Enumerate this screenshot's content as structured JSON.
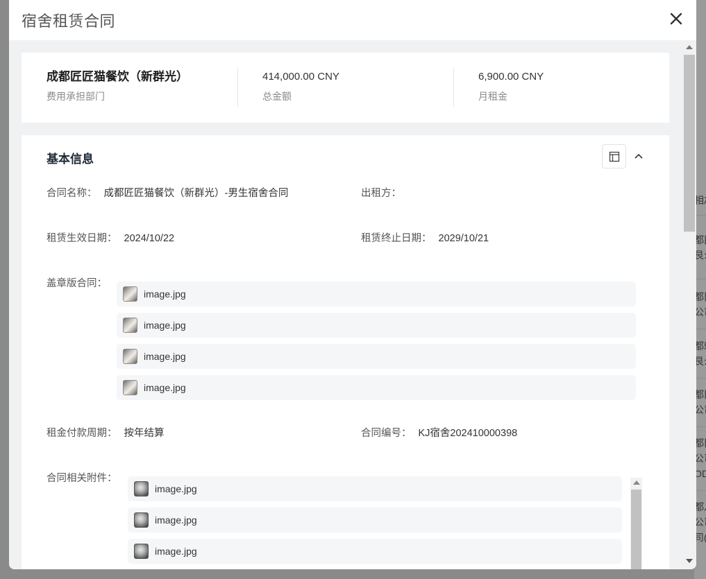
{
  "modal": {
    "title": "宿舍租赁合同"
  },
  "summary": [
    {
      "value": "成都匠匠猫餐饮（新群光）",
      "label": "费用承担部门"
    },
    {
      "value": "414,000.00 CNY",
      "label": "总金额"
    },
    {
      "value": "6,900.00 CNY",
      "label": "月租金"
    }
  ],
  "section": {
    "title": "基本信息"
  },
  "fields": {
    "contract_name": {
      "label": "合同名称：",
      "value": "成都匠匠猫餐饮（新群光）-男生宿舍合同"
    },
    "lessor": {
      "label": "出租方：",
      "value": ""
    },
    "start_date": {
      "label": "租赁生效日期：",
      "value": "2024/10/22"
    },
    "end_date": {
      "label": "租赁终止日期：",
      "value": "2029/10/21"
    },
    "stamped_contract": {
      "label": "盖章版合同："
    },
    "payment_cycle": {
      "label": "租金付款周期：",
      "value": "按年结算"
    },
    "contract_no": {
      "label": "合同编号：",
      "value": "KJ宿舍202410000398"
    },
    "attachments": {
      "label": "合同相关附件："
    }
  },
  "stamped_files": [
    "image.jpg",
    "image.jpg",
    "image.jpg",
    "image.jpg"
  ],
  "attachment_files": [
    "image.jpg",
    "image.jpg",
    "image.jpg"
  ],
  "background": {
    "strip_texts": [
      "相λ",
      "都民",
      "艮么",
      "都阝",
      "公司",
      "都剌",
      "艮么",
      "都阝",
      "公司",
      "都阝",
      "公司",
      "OD",
      "都八",
      "公司",
      "司("
    ]
  }
}
